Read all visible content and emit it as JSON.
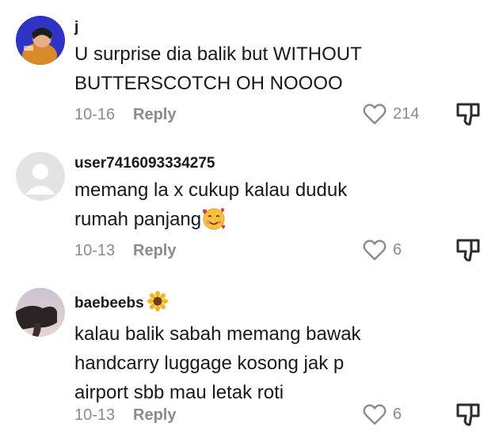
{
  "comments": [
    {
      "username": "j",
      "text_lines": [
        "U surprise dia balik but WITHOUT",
        "BUTTERSCOTCH OH NOOOO"
      ],
      "date": "10-16",
      "reply_label": "Reply",
      "likes": "214"
    },
    {
      "username": "user7416093334275",
      "text_lines": [
        "memang la x cukup kalau duduk",
        "rumah panjang"
      ],
      "date": "10-13",
      "reply_label": "Reply",
      "likes": "6"
    },
    {
      "username": "baebeebs",
      "text_lines": [
        "kalau balik sabah memang bawak",
        "handcarry luggage kosong jak p",
        "airport sbb mau letak roti"
      ],
      "date": "10-13",
      "reply_label": "Reply",
      "likes": "6"
    }
  ],
  "icons": {
    "like": "heart-outline-icon",
    "dislike": "thumbs-down-icon",
    "emoji_smile_hearts": "smiling-face-with-hearts-emoji",
    "emoji_sunflower": "sunflower-emoji"
  },
  "colors": {
    "text": "#161823",
    "meta": "#8a8b91"
  }
}
